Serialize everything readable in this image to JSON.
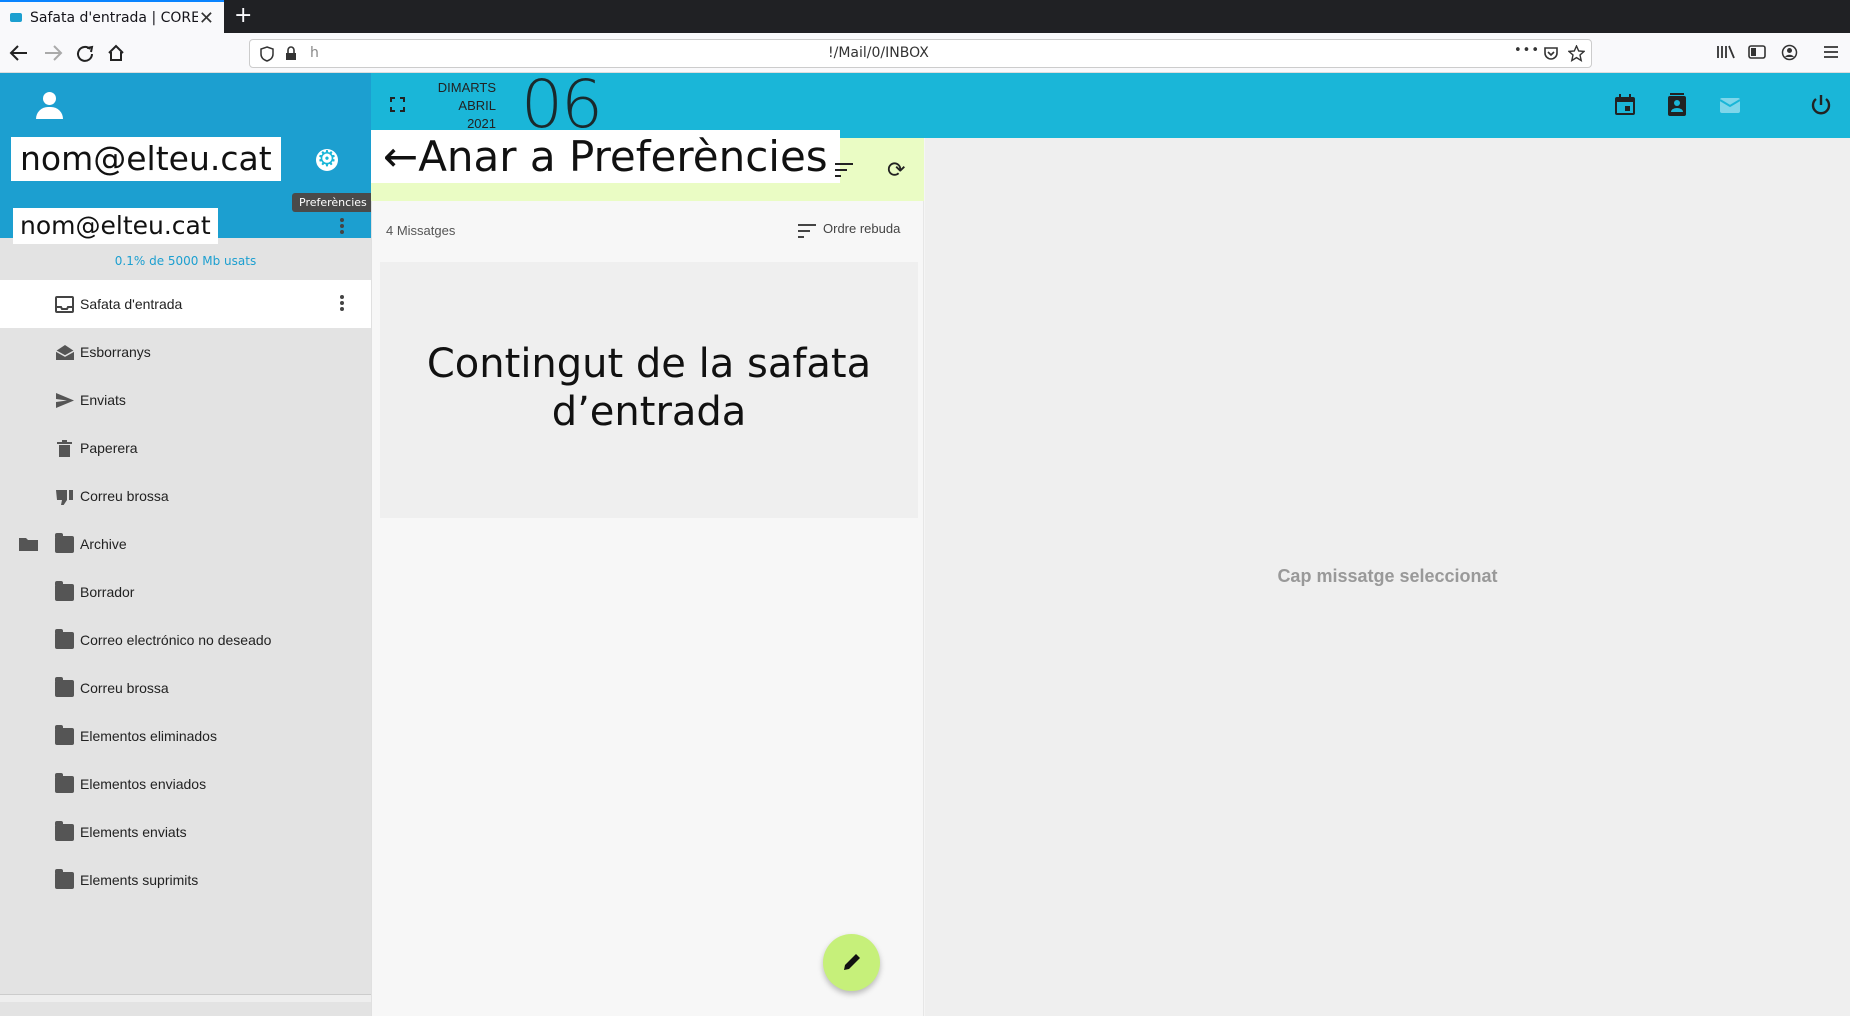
{
  "browser": {
    "tab_title": "Safata d'entrada | CORE",
    "tab_close": "✕",
    "new_tab": "+",
    "url_prefix": "h",
    "url": "!/Mail/0/INBOX",
    "menu_more": "•••"
  },
  "header": {
    "email_top": "nom@elteu.cat",
    "preferences_tooltip": "Preferències",
    "date_weekday": "DIMARTS",
    "date_month": "ABRIL",
    "date_year": "2021",
    "date_day": "06",
    "icons": [
      "calendar-icon",
      "contacts-icon",
      "mail-icon",
      "power-icon"
    ]
  },
  "sidebar": {
    "account_email": "nom@elteu.cat",
    "usage": "0.1% de 5000 Mb usats",
    "folders": [
      {
        "label": "Safata d'entrada",
        "icon": "inbox-icon"
      },
      {
        "label": "Esborranys",
        "icon": "drafts-icon"
      },
      {
        "label": "Enviats",
        "icon": "send-icon"
      },
      {
        "label": "Paperera",
        "icon": "trash-icon"
      },
      {
        "label": "Correu brossa",
        "icon": "spam-icon"
      },
      {
        "label": "Archive",
        "icon": "folder-icon"
      },
      {
        "label": "Borrador",
        "icon": "folder-icon"
      },
      {
        "label": "Correo electrónico no deseado",
        "icon": "folder-icon"
      },
      {
        "label": "Correu brossa",
        "icon": "folder-icon"
      },
      {
        "label": "Elementos eliminados",
        "icon": "folder-icon"
      },
      {
        "label": "Elementos enviados",
        "icon": "folder-icon"
      },
      {
        "label": "Elements enviats",
        "icon": "folder-icon"
      },
      {
        "label": "Elements suprimits",
        "icon": "folder-icon"
      }
    ]
  },
  "annotation": {
    "banner": "←Anar a Preferències",
    "inbox_content": "Contingut de la safata d’entrada"
  },
  "message_list": {
    "count": "4 Missatges",
    "order": "Ordre rebuda"
  },
  "reading_pane": {
    "empty": "Cap missatge seleccionat"
  },
  "colors": {
    "sidebar_header": "#1c9fd0",
    "topbar": "#1ab6d8",
    "toolbar_highlight": "#eafcc4",
    "compose": "#c6f07a"
  }
}
